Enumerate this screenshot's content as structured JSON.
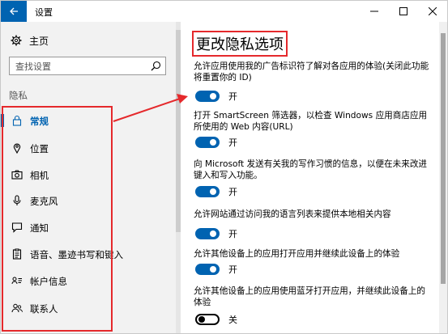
{
  "window": {
    "title": "设置",
    "colors": {
      "accent": "#0063b1",
      "highlight_red": "#e5292c",
      "sidebar_bg": "#f2f2f2"
    }
  },
  "sidebar": {
    "home_label": "主页",
    "search_placeholder": "查找设置",
    "group_label": "隐私",
    "items": [
      {
        "label": "常规",
        "icon": "lock-icon",
        "active": true
      },
      {
        "label": "位置",
        "icon": "location-pin-icon"
      },
      {
        "label": "相机",
        "icon": "camera-icon"
      },
      {
        "label": "麦克风",
        "icon": "microphone-icon"
      },
      {
        "label": "通知",
        "icon": "speech-bubble-icon"
      },
      {
        "label": "语音、墨迹书写和键入",
        "icon": "clipboard-icon"
      },
      {
        "label": "帐户信息",
        "icon": "account-card-icon"
      },
      {
        "label": "联系人",
        "icon": "contacts-icon"
      }
    ]
  },
  "main": {
    "title": "更改隐私选项",
    "settings": [
      {
        "description": "允许应用使用我的广告标识符了解对各应用的体验(关闭此功能将重置你的 ID)",
        "state": "开",
        "on": true
      },
      {
        "description": "打开 SmartScreen 筛选器，以检查 Windows 应用商店应用所使用的 Web 内容(URL)",
        "state": "开",
        "on": true
      },
      {
        "description": "向 Microsoft 发送有关我的写作习惯的信息，以便在未来改进键入和写入功能。",
        "state": "开",
        "on": true
      },
      {
        "description": "允许网站通过访问我的语言列表来提供本地相关内容",
        "state": "开",
        "on": true
      },
      {
        "description": "允许其他设备上的应用打开应用并继续此设备上的体验",
        "state": "开",
        "on": true
      },
      {
        "description": "允许其他设备上的应用使用蓝牙打开应用，并继续此设备上的体验",
        "state": "关",
        "on": false
      }
    ]
  }
}
